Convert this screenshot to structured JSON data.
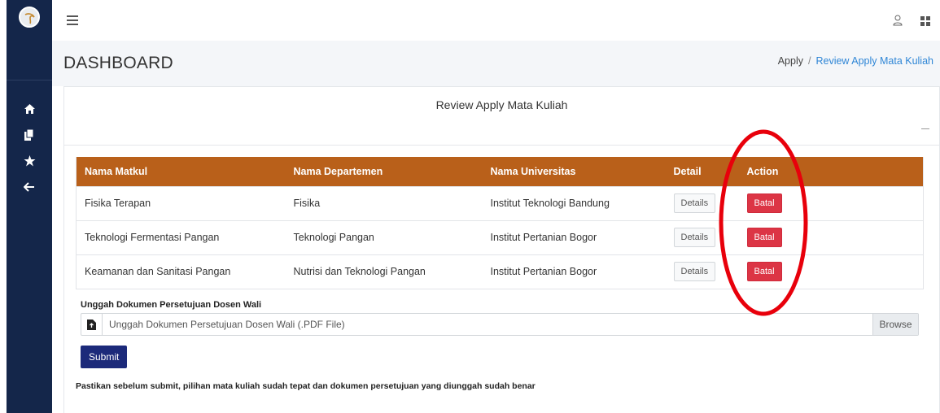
{
  "sidebar": {
    "logo": "logo-icon",
    "nav": [
      {
        "icon": "home-icon",
        "glyph": "⌂"
      },
      {
        "icon": "copy-icon",
        "glyph": "❐"
      },
      {
        "icon": "star-icon",
        "glyph": "★"
      },
      {
        "icon": "arrow-left-icon",
        "glyph": "←"
      }
    ]
  },
  "topbar": {
    "menu_icon": "menu-icon",
    "user_icon": "user-icon",
    "apps_icon": "grid-icon"
  },
  "header": {
    "title": "DASHBOARD",
    "breadcrumb": [
      "Apply",
      "Review Apply Mata Kuliah"
    ],
    "breadcrumb_sep": "/"
  },
  "card": {
    "title": "Review Apply Mata Kuliah"
  },
  "table": {
    "columns": [
      "Nama Matkul",
      "Nama Departemen",
      "Nama Universitas",
      "Detail",
      "Action"
    ],
    "rows": [
      {
        "matkul": "Fisika Terapan",
        "departemen": "Fisika",
        "universitas": "Institut Teknologi Bandung",
        "detail": "Details",
        "action": "Batal"
      },
      {
        "matkul": "Teknologi Fermentasi Pangan",
        "departemen": "Teknologi Pangan",
        "universitas": "Institut Pertanian Bogor",
        "detail": "Details",
        "action": "Batal"
      },
      {
        "matkul": "Keamanan dan Sanitasi Pangan",
        "departemen": "Nutrisi dan Teknologi Pangan",
        "universitas": "Institut Pertanian Bogor",
        "detail": "Details",
        "action": "Batal"
      }
    ]
  },
  "upload": {
    "label": "Unggah Dokumen Persetujuan Dosen Wali",
    "placeholder": "Unggah Dokumen Persetujuan Dosen Wali (.PDF File)",
    "browse": "Browse"
  },
  "submit_label": "Submit",
  "note": "Pastikan sebelum submit, pilihan mata kuliah sudah tepat dan dokumen persetujuan yang diunggah sudah benar",
  "colors": {
    "sidebar": "#14264a",
    "table_header": "#b9601a",
    "danger": "#dc3545",
    "submit": "#1c2a7a",
    "link": "#2f86d6",
    "annotation": "#e8000b"
  }
}
